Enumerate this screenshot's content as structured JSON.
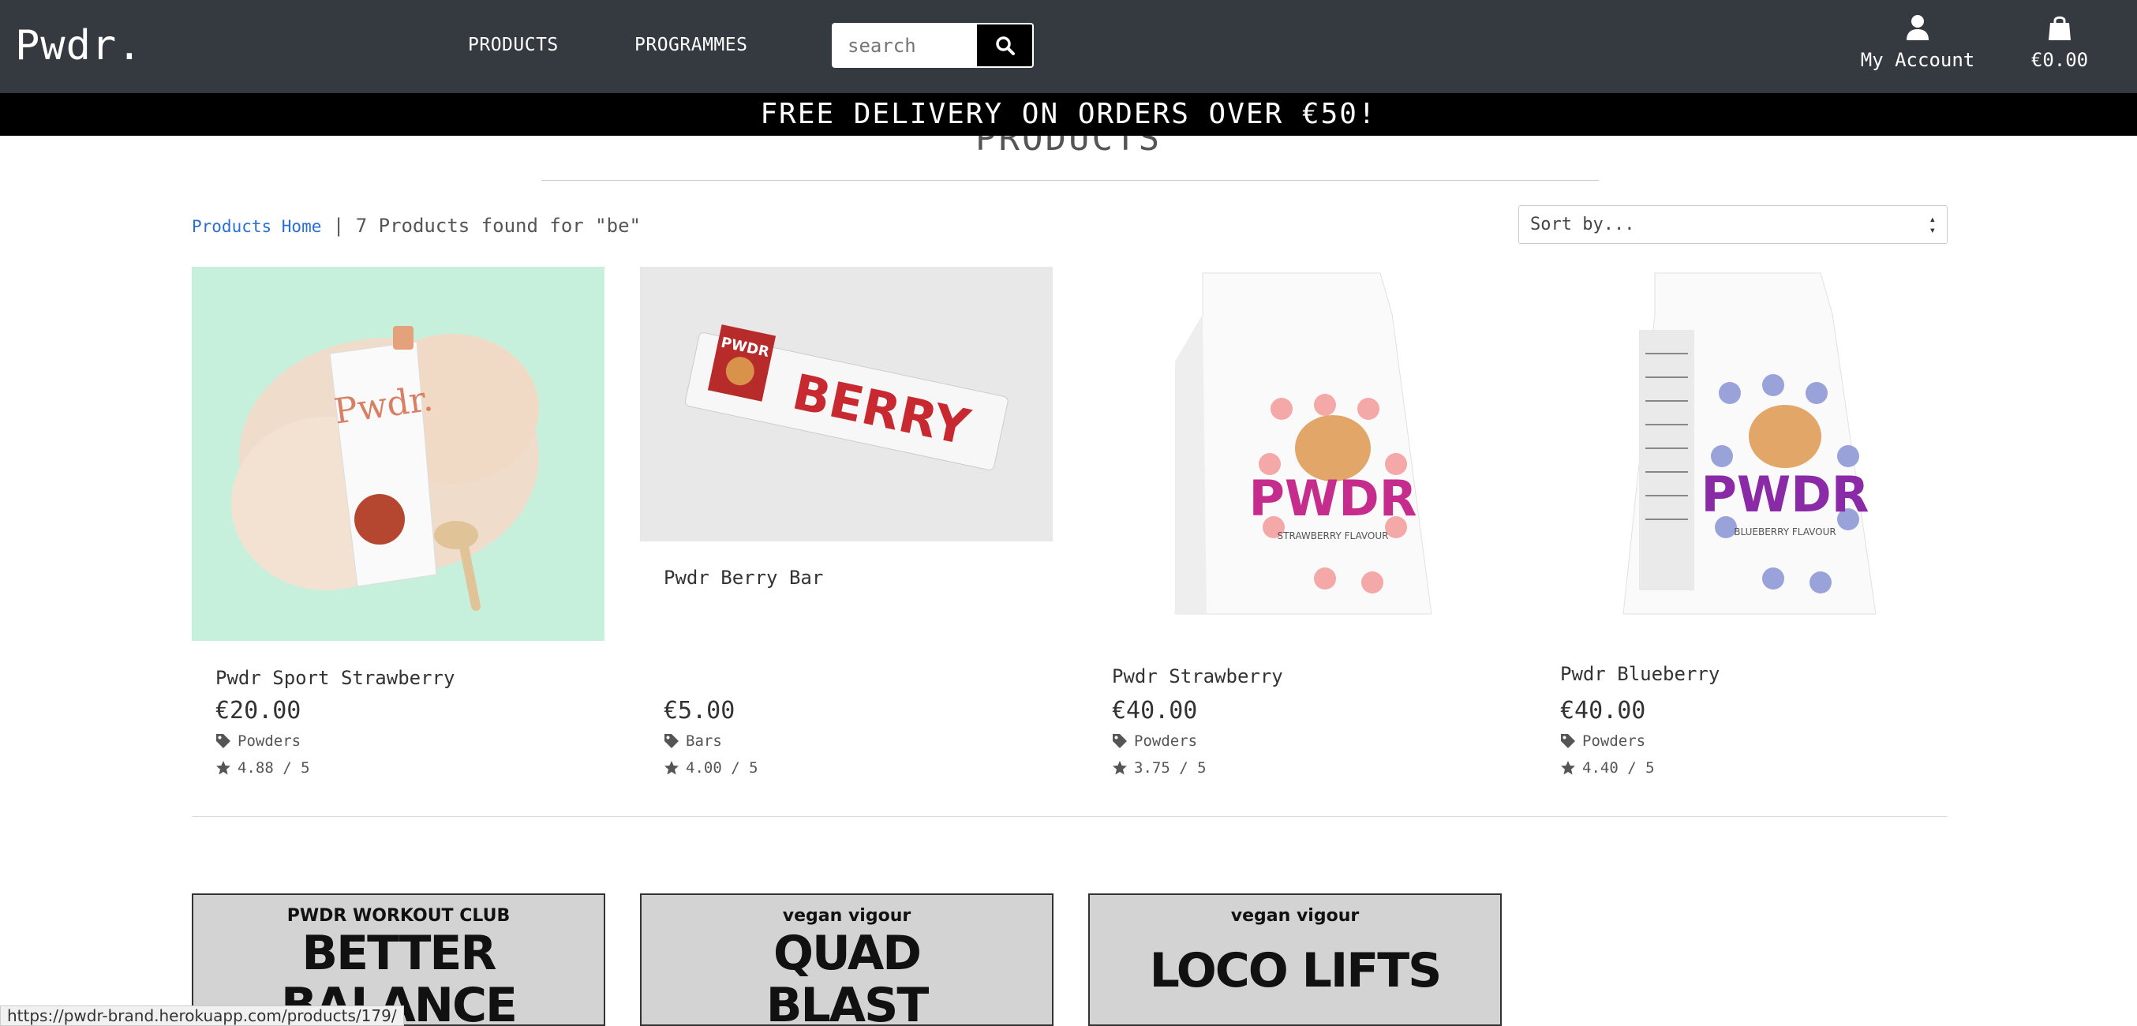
{
  "header": {
    "logo": "Pwdr.",
    "nav": [
      "PRODUCTS",
      "PROGRAMMES"
    ],
    "search_placeholder": "search",
    "account_label": "My Account",
    "bag_total": "€0.00"
  },
  "banner": "FREE DELIVERY ON ORDERS OVER €50!",
  "page_title": "PRODUCTS",
  "breadcrumb": {
    "home_link": "Products Home",
    "separator": "|",
    "result_text": "7 Products found for \"be\""
  },
  "sort": {
    "selected": "Sort by..."
  },
  "products": [
    {
      "name": "Pwdr Sport Strawberry",
      "price": "€20.00",
      "category": "Powders",
      "rating": "4.88 / 5"
    },
    {
      "name": "Pwdr Berry Bar",
      "price": "€5.00",
      "category": "Bars",
      "rating": "4.00 / 5",
      "image_text": "BERRY",
      "wrapper_logo": "PWDR"
    },
    {
      "name": "Pwdr Strawberry",
      "price": "€40.00",
      "category": "Powders",
      "rating": "3.75 / 5",
      "bag_text": "PWDR",
      "bag_flavour": "STRAWBERRY FLAVOUR"
    },
    {
      "name": "Pwdr Blueberry",
      "price": "€40.00",
      "category": "Powders",
      "rating": "4.40 / 5",
      "bag_text": "PWDR",
      "bag_flavour": "BLUEBERRY FLAVOUR"
    }
  ],
  "programmes": [
    {
      "kicker": "PWDR WORKOUT CLUB",
      "title_line1": "BETTER",
      "title_line2": "BALANCE"
    },
    {
      "kicker": "vegan vigour",
      "title_line1": "QUAD",
      "title_line2": "BLAST"
    },
    {
      "kicker": "vegan vigour",
      "title_line1": "LOCO LIFTS",
      "title_line2": ""
    }
  ],
  "status_bar_url": "https://pwdr-brand.herokuapp.com/products/179/",
  "colors": {
    "header_bg": "#343a40",
    "banner_bg": "#000000",
    "link": "#2a6fd6"
  },
  "icons": {
    "search": "search-icon",
    "account": "user-icon",
    "bag": "shopping-bag-icon",
    "tag": "tag-icon",
    "star": "star-icon"
  }
}
